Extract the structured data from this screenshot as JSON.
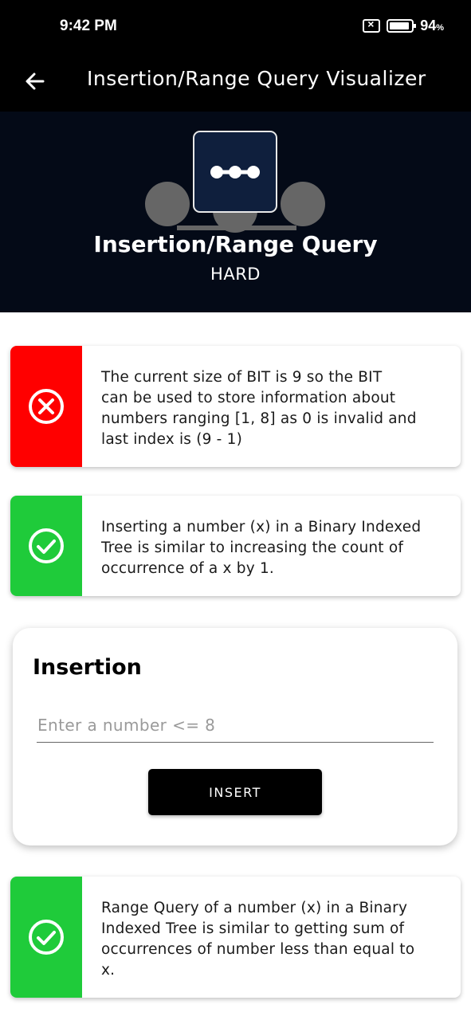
{
  "status_bar": {
    "time": "9:42 PM",
    "battery": "94",
    "battery_unit": "%",
    "icons": [
      "sim-off-icon",
      "battery-icon"
    ]
  },
  "app_bar": {
    "title": "Insertion/Range Query Visualizer",
    "back_icon": "arrow-left-icon"
  },
  "hero": {
    "title": "Insertion/Range Query",
    "difficulty": "HARD",
    "logo_icon": "linked-nodes-icon",
    "colors": {
      "background": "#040a17",
      "logo_bg": "#0f1f3d",
      "nodes": "#666666"
    }
  },
  "cards": [
    {
      "status": "error",
      "icon": "error-circle-icon",
      "color": "#ff0000",
      "lines": [
        "The current size of BIT is 9 so the BIT",
        "can be used to store information about",
        "numbers ranging [1, 8] as 0 is invalid and",
        "last index is (9 - 1)"
      ]
    },
    {
      "status": "success",
      "icon": "check-circle-icon",
      "color": "#1fcb3a",
      "lines": [
        "Inserting a number (x) in a Binary Indexed",
        "Tree is similar to increasing the count of",
        "occurrence of a x by 1."
      ]
    },
    {
      "status": "success",
      "icon": "check-circle-icon",
      "color": "#1fcb3a",
      "lines": [
        "Range Query of a number (x) in a Binary",
        "Indexed Tree is similar to getting sum of",
        "occurrences of number less than equal to",
        "x."
      ]
    }
  ],
  "insertion": {
    "title": "Insertion",
    "input_value": "",
    "input_placeholder": "Enter a number <= 8",
    "button_label": "INSERT"
  }
}
